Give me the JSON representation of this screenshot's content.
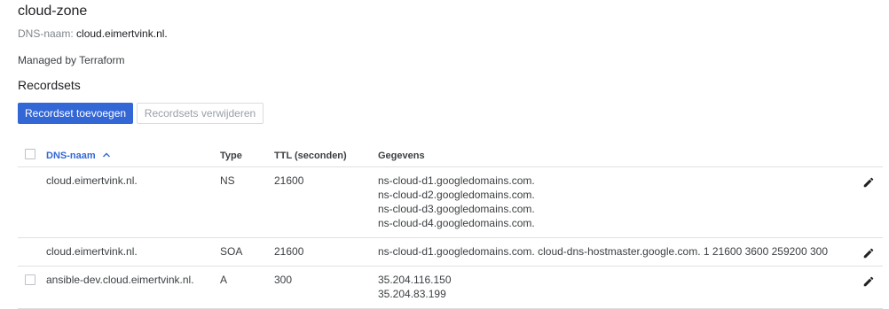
{
  "zone": {
    "title": "cloud-zone",
    "dns_label": "DNS-naam:",
    "dns_value": "cloud.eimertvink.nl.",
    "managed_by": "Managed by Terraform"
  },
  "recordsets": {
    "section_title": "Recordsets",
    "add_button": "Recordset toevoegen",
    "delete_button": "Recordsets verwijderen"
  },
  "table": {
    "columns": {
      "name": "DNS-naam",
      "type": "Type",
      "ttl": "TTL (seconden)",
      "data": "Gegevens"
    },
    "sort_icon": "arrow-up-icon",
    "rows": [
      {
        "name": "cloud.eimertvink.nl.",
        "type": "NS",
        "ttl": "21600",
        "data": [
          "ns-cloud-d1.googledomains.com.",
          "ns-cloud-d2.googledomains.com.",
          "ns-cloud-d3.googledomains.com.",
          "ns-cloud-d4.googledomains.com."
        ],
        "selectable": false
      },
      {
        "name": "cloud.eimertvink.nl.",
        "type": "SOA",
        "ttl": "21600",
        "data": [
          "ns-cloud-d1.googledomains.com. cloud-dns-hostmaster.google.com. 1 21600 3600 259200 300"
        ],
        "selectable": false
      },
      {
        "name": "ansible-dev.cloud.eimertvink.nl.",
        "type": "A",
        "ttl": "300",
        "data": [
          "35.204.116.150",
          "35.204.83.199"
        ],
        "selectable": true
      }
    ]
  },
  "colors": {
    "primary": "#3367d6",
    "divider": "#e0e0e0",
    "muted_text": "#80868b"
  }
}
